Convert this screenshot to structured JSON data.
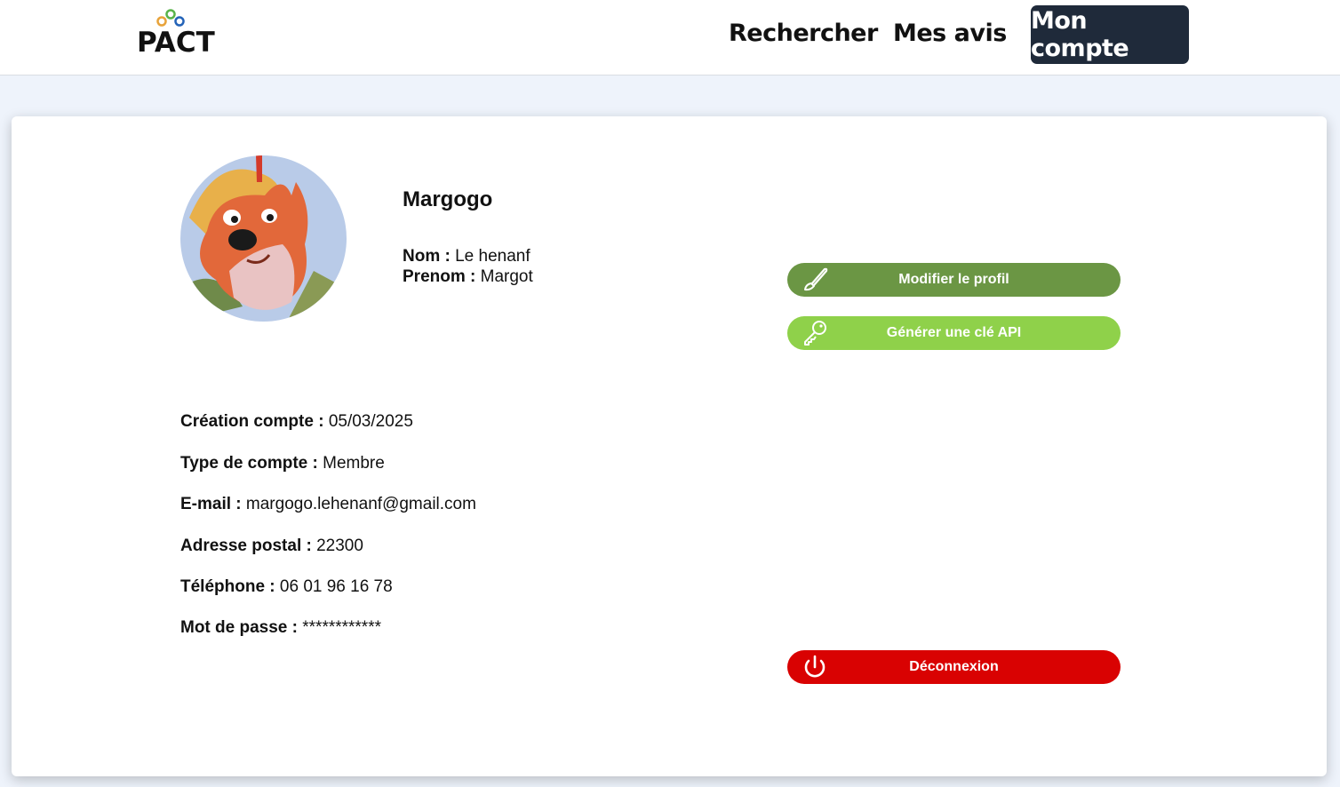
{
  "header": {
    "logo_text": "PACT",
    "nav": {
      "search": "Rechercher",
      "reviews": "Mes avis",
      "account": "Mon compte"
    }
  },
  "profile": {
    "username": "Margogo",
    "nom_label": "Nom :",
    "nom_value": "Le henanf",
    "prenom_label": "Prenom :",
    "prenom_value": "Margot"
  },
  "actions": {
    "edit_label": "Modifier le profil",
    "api_label": "Générer une clé API",
    "logout_label": "Déconnexion"
  },
  "details": [
    {
      "label": "Création compte :",
      "value": "05/03/2025"
    },
    {
      "label": "Type de compte :",
      "value": "Membre"
    },
    {
      "label": "E-mail :",
      "value": "margogo.lehenanf@gmail.com"
    },
    {
      "label": "Adresse postal :",
      "value": "22300"
    },
    {
      "label": "Téléphone :",
      "value": "06 01 96 16 78"
    },
    {
      "label": "Mot de passe :",
      "value": "************"
    }
  ],
  "colors": {
    "nav_active_bg": "#1f2a3a",
    "edit_button": "#6b9644",
    "api_button": "#8fd14a",
    "logout_button": "#d90202",
    "page_bg": "#eef3fb"
  },
  "icons": {
    "edit": "brush-icon",
    "api": "key-icon",
    "logout": "power-icon"
  }
}
